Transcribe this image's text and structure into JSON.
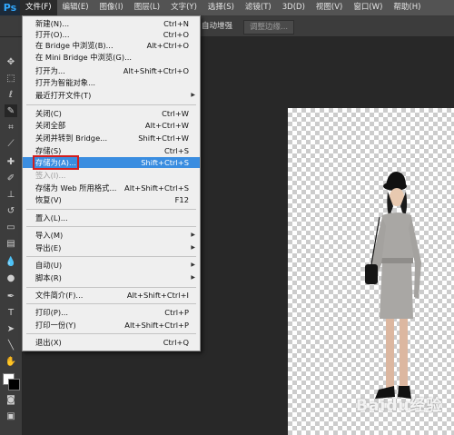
{
  "menubar": {
    "logo": "Ps",
    "items": [
      "文件(F)",
      "编辑(E)",
      "图像(I)",
      "图层(L)",
      "文字(Y)",
      "选择(S)",
      "滤镜(T)",
      "3D(D)",
      "视图(V)",
      "窗口(W)",
      "帮助(H)"
    ]
  },
  "optbar": {
    "auto_enhance": "自动增强",
    "refine_edge": "调整边缘..."
  },
  "file_menu": {
    "new": {
      "label": "新建(N)...",
      "shortcut": "Ctrl+N"
    },
    "open": {
      "label": "打开(O)...",
      "shortcut": "Ctrl+O"
    },
    "browse_bridge": {
      "label": "在 Bridge 中浏览(B)...",
      "shortcut": "Alt+Ctrl+O"
    },
    "browse_mini": {
      "label": "在 Mini Bridge 中浏览(G)..."
    },
    "open_as": {
      "label": "打开为...",
      "shortcut": "Alt+Shift+Ctrl+O"
    },
    "open_smart": {
      "label": "打开为智能对象..."
    },
    "recent": {
      "label": "最近打开文件(T)"
    },
    "close": {
      "label": "关闭(C)",
      "shortcut": "Ctrl+W"
    },
    "close_all": {
      "label": "关闭全部",
      "shortcut": "Alt+Ctrl+W"
    },
    "close_bridge": {
      "label": "关闭并转到 Bridge...",
      "shortcut": "Shift+Ctrl+W"
    },
    "save": {
      "label": "存储(S)",
      "shortcut": "Ctrl+S"
    },
    "save_as": {
      "label": "存储为(A)...",
      "shortcut": "Shift+Ctrl+S"
    },
    "check_in": {
      "label": "签入(I)..."
    },
    "save_web": {
      "label": "存储为 Web 所用格式...",
      "shortcut": "Alt+Shift+Ctrl+S"
    },
    "revert": {
      "label": "恢复(V)",
      "shortcut": "F12"
    },
    "place": {
      "label": "置入(L)..."
    },
    "import": {
      "label": "导入(M)"
    },
    "export": {
      "label": "导出(E)"
    },
    "automate": {
      "label": "自动(U)"
    },
    "scripts": {
      "label": "脚本(R)"
    },
    "file_info": {
      "label": "文件简介(F)...",
      "shortcut": "Alt+Shift+Ctrl+I"
    },
    "print": {
      "label": "打印(P)...",
      "shortcut": "Ctrl+P"
    },
    "print_one": {
      "label": "打印一份(Y)",
      "shortcut": "Alt+Shift+Ctrl+P"
    },
    "exit": {
      "label": "退出(X)",
      "shortcut": "Ctrl+Q"
    }
  },
  "watermark": "Baidu经验",
  "colors": {
    "highlight": "#3a8de0",
    "annotation_box": "#d21e1e",
    "menubar": "#535353"
  }
}
